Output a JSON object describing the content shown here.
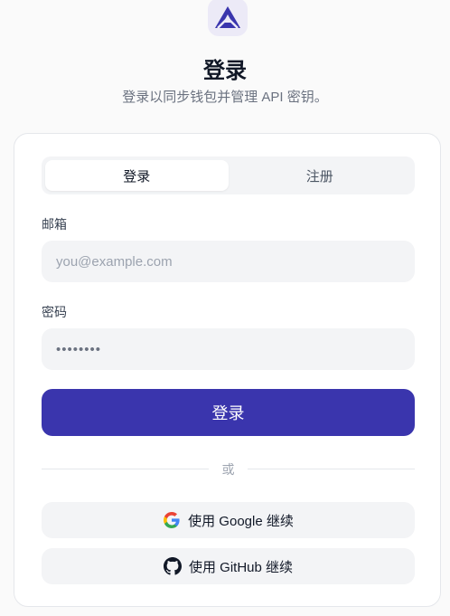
{
  "header": {
    "title": "登录",
    "subtitle": "登录以同步钱包并管理 API 密钥。"
  },
  "tabs": [
    {
      "label": "登录",
      "active": true
    },
    {
      "label": "注册",
      "active": false
    }
  ],
  "form": {
    "email_label": "邮箱",
    "email_placeholder": "you@example.com",
    "email_value": "",
    "password_label": "密码",
    "password_placeholder": "••••••••",
    "password_value": "",
    "submit_label": "登录"
  },
  "divider_label": "或",
  "oauth": {
    "google_label": "使用 Google 继续",
    "github_label": "使用 GitHub 继续"
  },
  "colors": {
    "primary": "#3a35ad",
    "logo_bg": "#eceaf7",
    "field_bg": "#f3f4f6"
  },
  "icons": {
    "logo": "app-logo-icon",
    "google": "google-icon",
    "github": "github-icon"
  }
}
